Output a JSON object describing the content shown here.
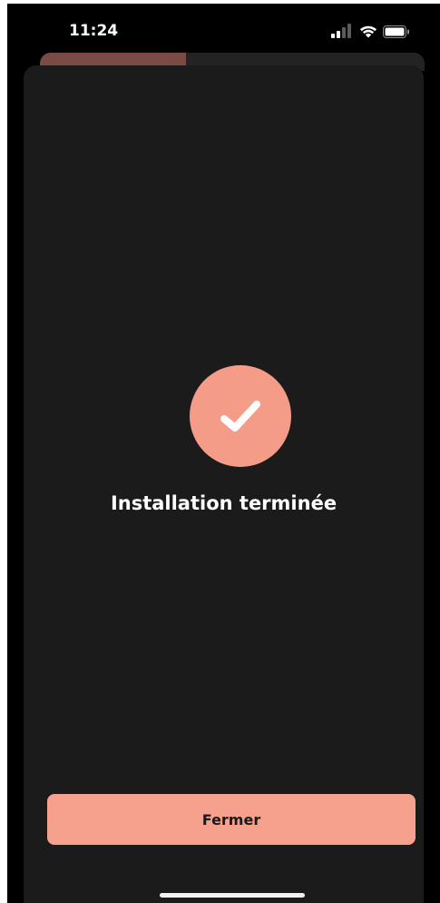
{
  "status_bar": {
    "time": "11:24",
    "icons": [
      "signal-icon",
      "wifi-icon",
      "battery-icon"
    ]
  },
  "progress": {
    "value": 0.38,
    "fill_color": "#7b4a44",
    "track_color": "#232323"
  },
  "main": {
    "icon": "check-icon",
    "icon_bg_color": "#f59c88",
    "title": "Installation terminée"
  },
  "footer": {
    "close_label": "Fermer",
    "button_color": "#f6a08e"
  }
}
